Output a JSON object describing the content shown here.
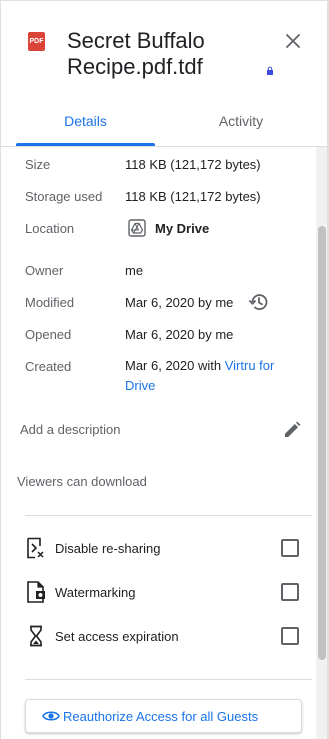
{
  "file": {
    "icon_text": "PDF",
    "title": "Secret Buffalo Recipe.pdf.tdf"
  },
  "tabs": [
    {
      "label": "Details"
    },
    {
      "label": "Activity"
    }
  ],
  "active_tab": "Details",
  "details": {
    "size": {
      "label": "Size",
      "value": "118 KB (121,172 bytes)"
    },
    "storage": {
      "label": "Storage used",
      "value": "118 KB (121,172 bytes)"
    },
    "location": {
      "label": "Location",
      "value": "My Drive"
    },
    "owner": {
      "label": "Owner",
      "value": "me"
    },
    "modified": {
      "label": "Modified",
      "value": "Mar 6, 2020 by me"
    },
    "opened": {
      "label": "Opened",
      "value": "Mar 6, 2020 by me"
    },
    "created": {
      "label": "Created",
      "value_prefix": "Mar 6, 2020 with ",
      "link_line1": "Virtru for",
      "link_line2": "Drive"
    }
  },
  "description": {
    "placeholder": "Add a description"
  },
  "viewers": {
    "label": "Viewers can download"
  },
  "options": [
    {
      "label": "Disable re-sharing",
      "checked": false
    },
    {
      "label": "Watermarking",
      "checked": false
    },
    {
      "label": "Set access expiration",
      "checked": false
    }
  ],
  "reauthorize": {
    "label": "Reauthorize Access for all Guests"
  },
  "colors": {
    "accent": "#1a73e8",
    "pdf_red": "#db4437",
    "text": "#202124",
    "secondary_text": "#5f6368"
  }
}
